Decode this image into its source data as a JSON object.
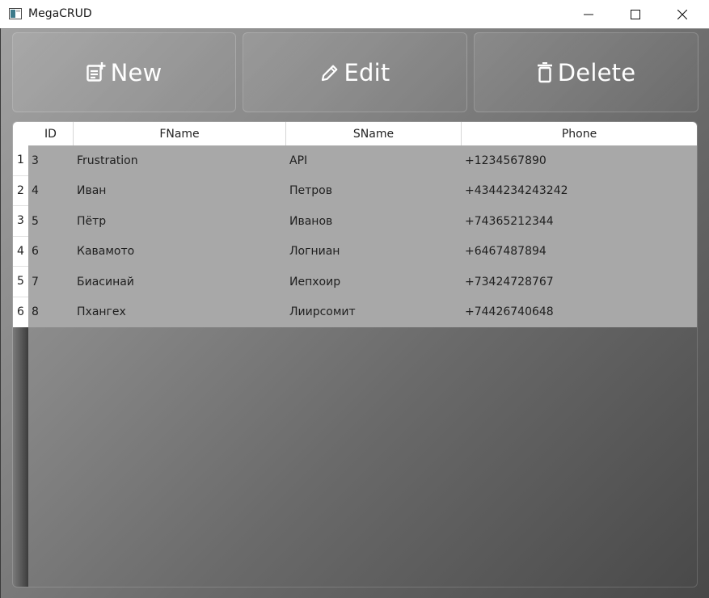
{
  "window": {
    "title": "MegaCRUD",
    "controls": [
      "minimize",
      "maximize",
      "close"
    ]
  },
  "toolbar": {
    "new_label": "New",
    "edit_label": "Edit",
    "delete_label": "Delete",
    "icons": {
      "new": "note-add-icon",
      "edit": "pencil-icon",
      "delete": "trash-icon"
    }
  },
  "grid": {
    "columns": [
      "ID",
      "FName",
      "SName",
      "Phone"
    ],
    "rows": [
      {
        "num": "1",
        "id": "3",
        "fname": "Frustration",
        "sname": "API",
        "phone": "+1234567890"
      },
      {
        "num": "2",
        "id": "4",
        "fname": "Иван",
        "sname": "Петров",
        "phone": "+4344234243242"
      },
      {
        "num": "3",
        "id": "5",
        "fname": "Пётр",
        "sname": "Иванов",
        "phone": "+74365212344"
      },
      {
        "num": "4",
        "id": "6",
        "fname": "Кавамото",
        "sname": "Логниан",
        "phone": "+6467487894"
      },
      {
        "num": "5",
        "id": "7",
        "fname": "Биасинай",
        "sname": "Иепхоир",
        "phone": "+73424728767"
      },
      {
        "num": "6",
        "id": "8",
        "fname": "Пхангех",
        "sname": "Лиирсомит",
        "phone": "+74426740648"
      }
    ]
  },
  "colors": {
    "row_background": "#a8a8a8",
    "header_background": "#ffffff",
    "button_text": "#ffffff"
  }
}
